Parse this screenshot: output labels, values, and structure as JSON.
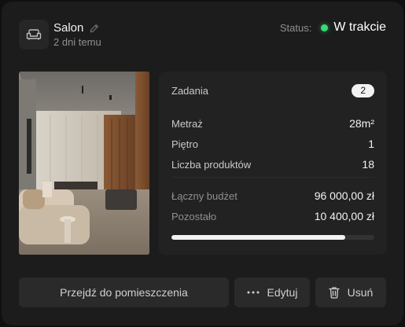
{
  "room": {
    "name": "Salon",
    "subtitle": "2 dni temu",
    "icon": "sofa-icon"
  },
  "status": {
    "label": "Status:",
    "value": "W trakcie",
    "color": "#39d97a"
  },
  "details": {
    "tasks_label": "Zadania",
    "tasks_count": "2",
    "area_label": "Metraż",
    "area_value": "28m²",
    "floor_label": "Piętro",
    "floor_value": "1",
    "products_label": "Liczba produktów",
    "products_value": "18",
    "budget_label": "Łączny budżet",
    "budget_value": "96 000,00 zł",
    "remaining_label": "Pozostało",
    "remaining_value": "10 400,00 zł",
    "budget_progress": 0.855
  },
  "actions": {
    "go_label": "Przejdź do pomieszczenia",
    "edit_label": "Edytuj",
    "delete_label": "Usuń"
  }
}
